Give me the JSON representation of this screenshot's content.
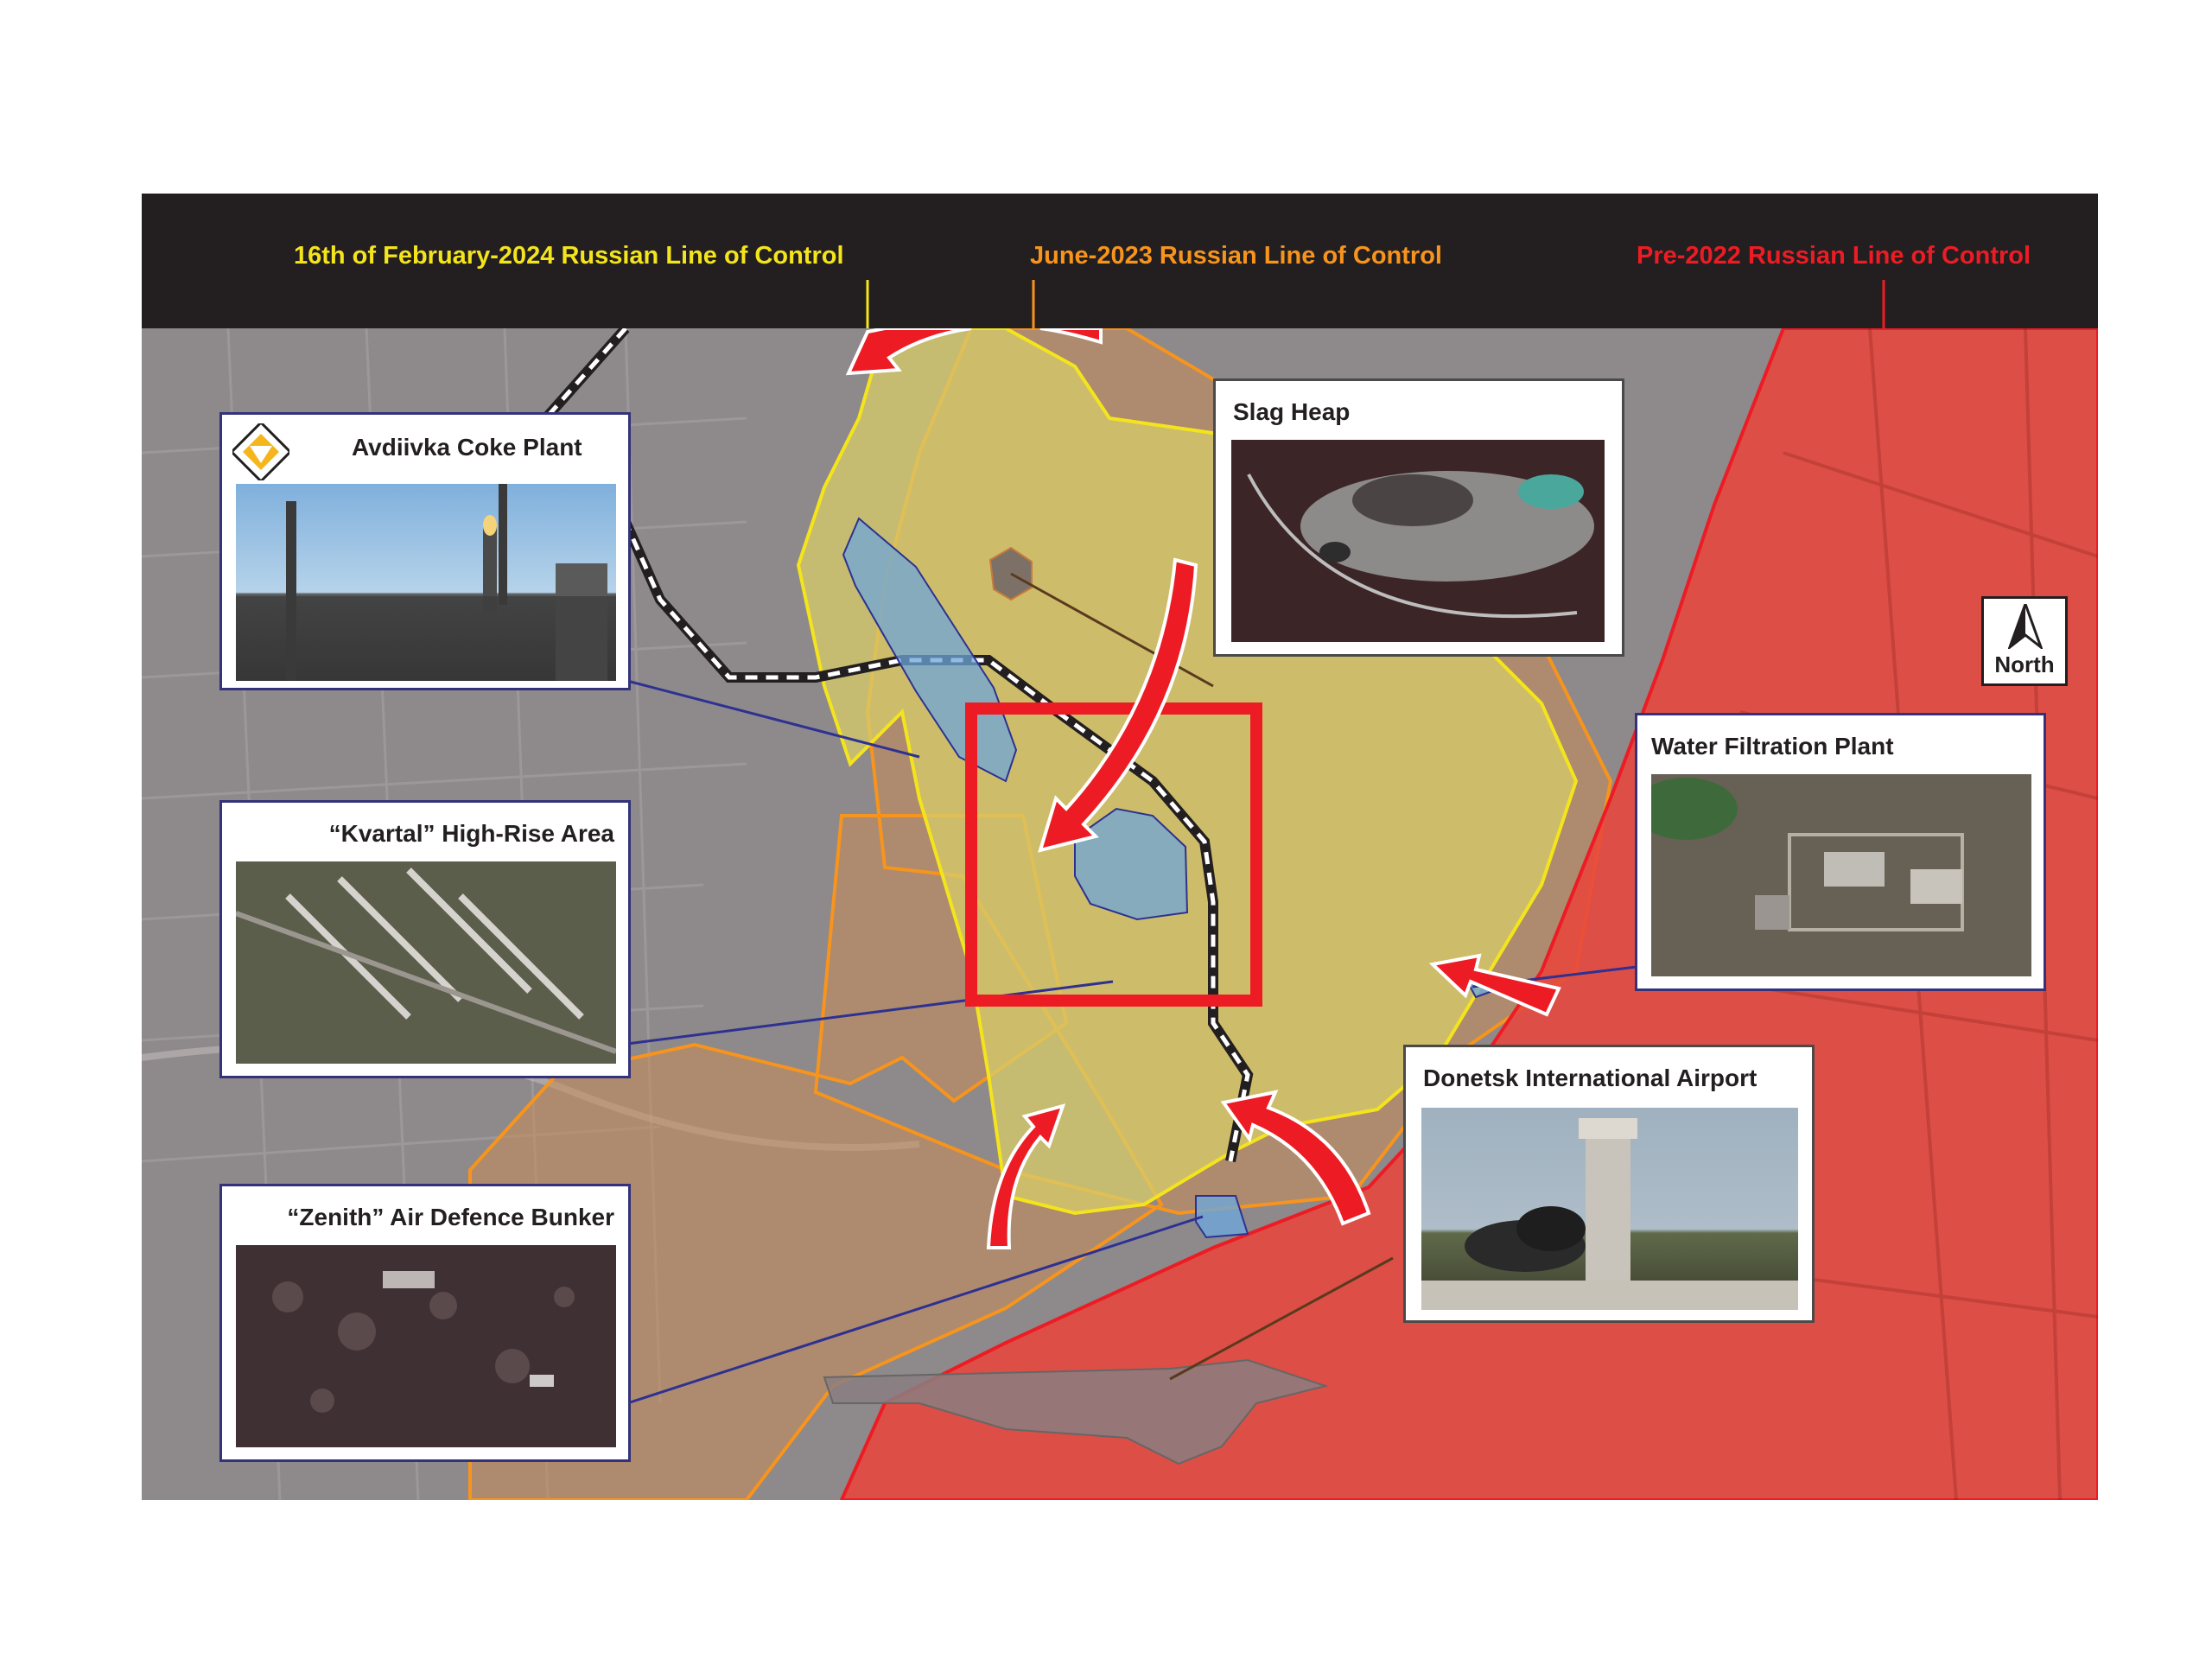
{
  "legend": {
    "feb_2024": "16th of February-2024 Russian Line of Control",
    "jun_2023": "June-2023 Russian Line of Control",
    "pre_2022": "Pre-2022 Russian Line of Control"
  },
  "colors": {
    "feb_2024": "#f4e41c",
    "jun_2023": "#f7941d",
    "pre_2022": "#ed1c24",
    "header_bg": "#231f20",
    "callout_border": "#33327a",
    "target_area": "#6ea6d8",
    "attack_arrow": "#ed1c24"
  },
  "callouts": {
    "coke_plant": "Avdiivka Coke Plant",
    "slag_heap": "Slag Heap",
    "water_plant": "Water Filtration Plant",
    "kvartal": "“Kvartal” High-Rise Area",
    "airport": "Donetsk International Airport",
    "zenith": "“Zenith” Air Defence Bunker"
  },
  "north": {
    "label": "North",
    "icon": "north-arrow-icon"
  }
}
